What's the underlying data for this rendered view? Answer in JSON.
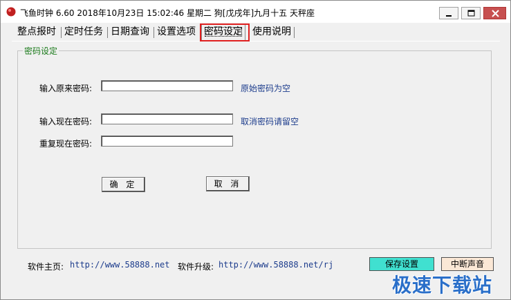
{
  "window": {
    "title": "飞鱼时钟 6.60 2018年10月23日 15:02:46 星期二 狗[戊戌年]九月十五 天秤座"
  },
  "tabs": [
    {
      "label": "整点报时"
    },
    {
      "label": "定时任务"
    },
    {
      "label": "日期查询"
    },
    {
      "label": "设置选项"
    },
    {
      "label": "密码设定",
      "active": true
    },
    {
      "label": "使用说明"
    }
  ],
  "password_group": {
    "title": "密码设定",
    "original_label": "输入原来密码:",
    "original_value": "",
    "original_hint": "原始密码为空",
    "new_label": "输入现在密码:",
    "new_value": "",
    "new_hint": "取消密码请留空",
    "repeat_label": "重复现在密码:",
    "repeat_value": "",
    "confirm_label": "确 定",
    "cancel_label": "取 消"
  },
  "footer": {
    "home_label": "软件主页:",
    "home_url": "http://www.58888.net",
    "upgrade_label": "软件升级:",
    "upgrade_url": "http://www.58888.net/rj",
    "save_label": "保存设置",
    "mute_label": "中断声音"
  },
  "watermark": "极速下载站",
  "colors": {
    "save_button": "#40e0d0",
    "mute_button": "#fbe8d6",
    "link": "#1c3c8c",
    "group_title": "#1a7a1a",
    "highlight": "#e02020"
  }
}
